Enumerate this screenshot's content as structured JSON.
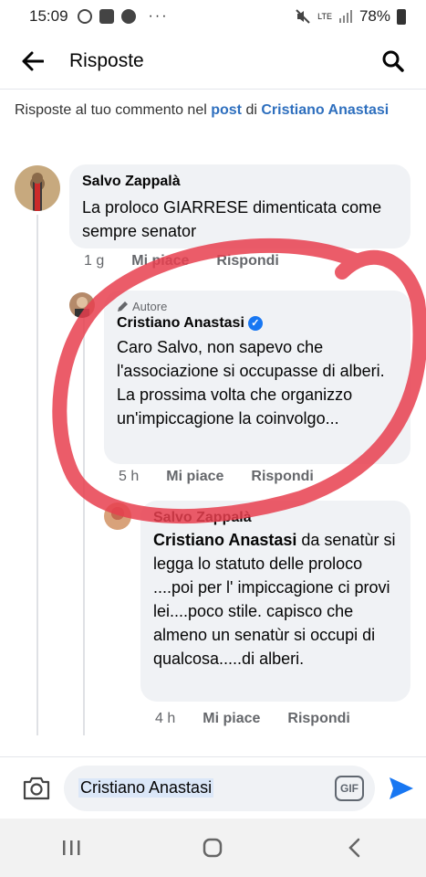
{
  "status_bar": {
    "time": "15:09",
    "network": "LTE",
    "battery": "78%"
  },
  "header": {
    "title": "Risposte"
  },
  "context": {
    "prefix": "Risposte al tuo commento nel ",
    "post_link": "post",
    "middle": " di ",
    "person": "Cristiano Anastasi"
  },
  "comments": [
    {
      "author": "Salvo Zappalà",
      "text": "La proloco GIARRESE  dimenticata come sempre  senator",
      "time": "1 g",
      "like": "Mi piace",
      "reply": "Rispondi"
    },
    {
      "badge": "Autore",
      "author": "Cristiano Anastasi",
      "text": "Caro Salvo, non sapevo che l'associazione si occupasse di alberi.\nLa prossima volta che organizzo un'impiccagione la coinvolgo...",
      "time": "5 h",
      "like": "Mi piace",
      "reply": "Rispondi"
    },
    {
      "author": "Salvo Zappalà",
      "mention": "Cristiano Anastasi",
      "text": " da senatùr si legga lo statuto delle proloco  ....poi per l' impiccagione ci provi lei....poco stile. capisco che almeno  un senatùr si occupi di qualcosa.....di alberi.",
      "time": "4 h",
      "like": "Mi piace",
      "reply": "Rispondi"
    }
  ],
  "composer": {
    "value": "Cristiano Anastasi",
    "gif": "GIF"
  },
  "icons": [
    "whatsapp-icon",
    "mail-icon",
    "facebook-icon",
    "mute-icon",
    "signal-icon",
    "battery-icon",
    "back-arrow-icon",
    "search-icon",
    "camera-icon",
    "send-icon",
    "recent-apps-icon",
    "home-icon",
    "back-icon",
    "verified-icon",
    "pencil-icon"
  ],
  "colors": {
    "link": "#2e6fbe",
    "bubble": "#f0f2f5",
    "send": "#1877f2",
    "annotation": "#e8404f"
  }
}
